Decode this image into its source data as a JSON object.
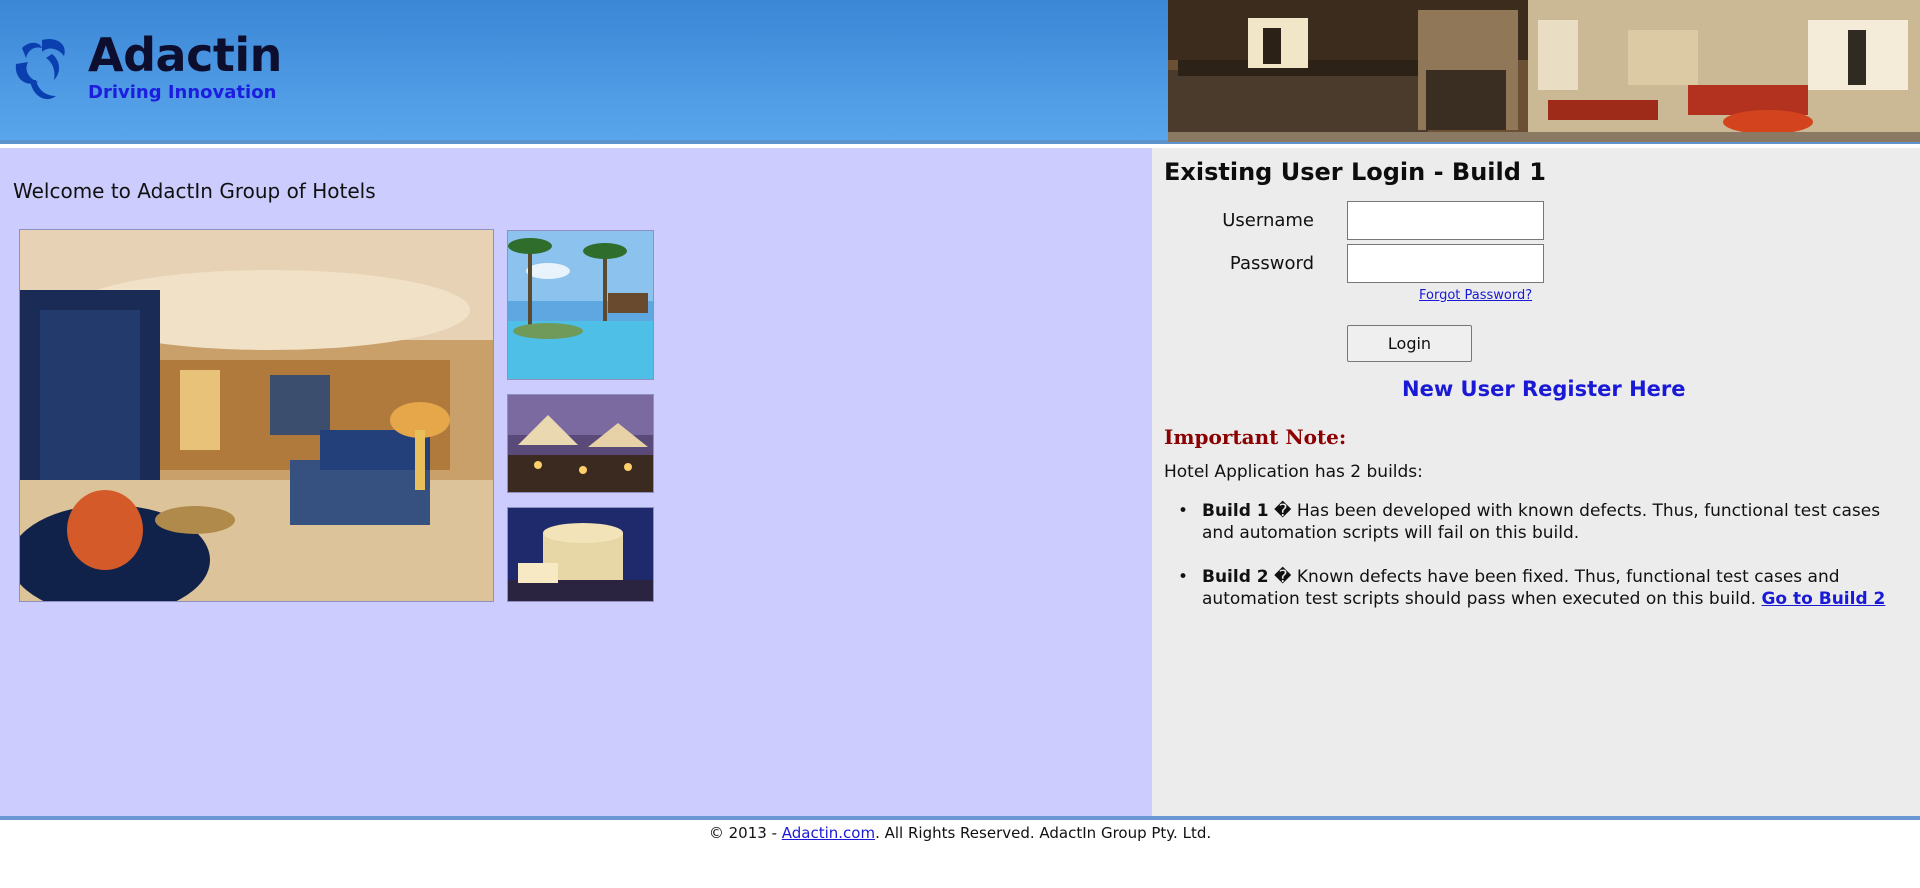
{
  "header": {
    "logo_name": "Adactin",
    "logo_tagline": "Driving Innovation",
    "brand_color": "#1d1de0"
  },
  "left": {
    "welcome": "Welcome to AdactIn Group of Hotels"
  },
  "login": {
    "title": "Existing User Login - Build 1",
    "username_label": "Username",
    "username_value": "",
    "password_label": "Password",
    "password_value": "",
    "forgot": "Forgot Password?",
    "login_button": "Login",
    "register": "New User Register Here"
  },
  "note": {
    "title": "Important Note:",
    "intro": "Hotel Application has 2 builds:",
    "builds": [
      {
        "name": "Build 1",
        "sep": " � ",
        "text": "Has been developed with known defects. Thus, functional test cases and automation scripts will fail on this build."
      },
      {
        "name": "Build 2",
        "sep": " � ",
        "text": "Known defects have been fixed. Thus, functional test cases and automation test scripts should pass when executed on this build. ",
        "link": "Go to Build 2"
      }
    ]
  },
  "footer": {
    "prefix": "© 2013 - ",
    "link": "Adactin.com",
    "suffix": ". All Rights Reserved. AdactIn Group Pty. Ltd."
  },
  "colors": {
    "left_panel": "#ccccff",
    "right_panel": "#ececec",
    "note_title": "#8b0000",
    "link": "#1a1ad6"
  }
}
